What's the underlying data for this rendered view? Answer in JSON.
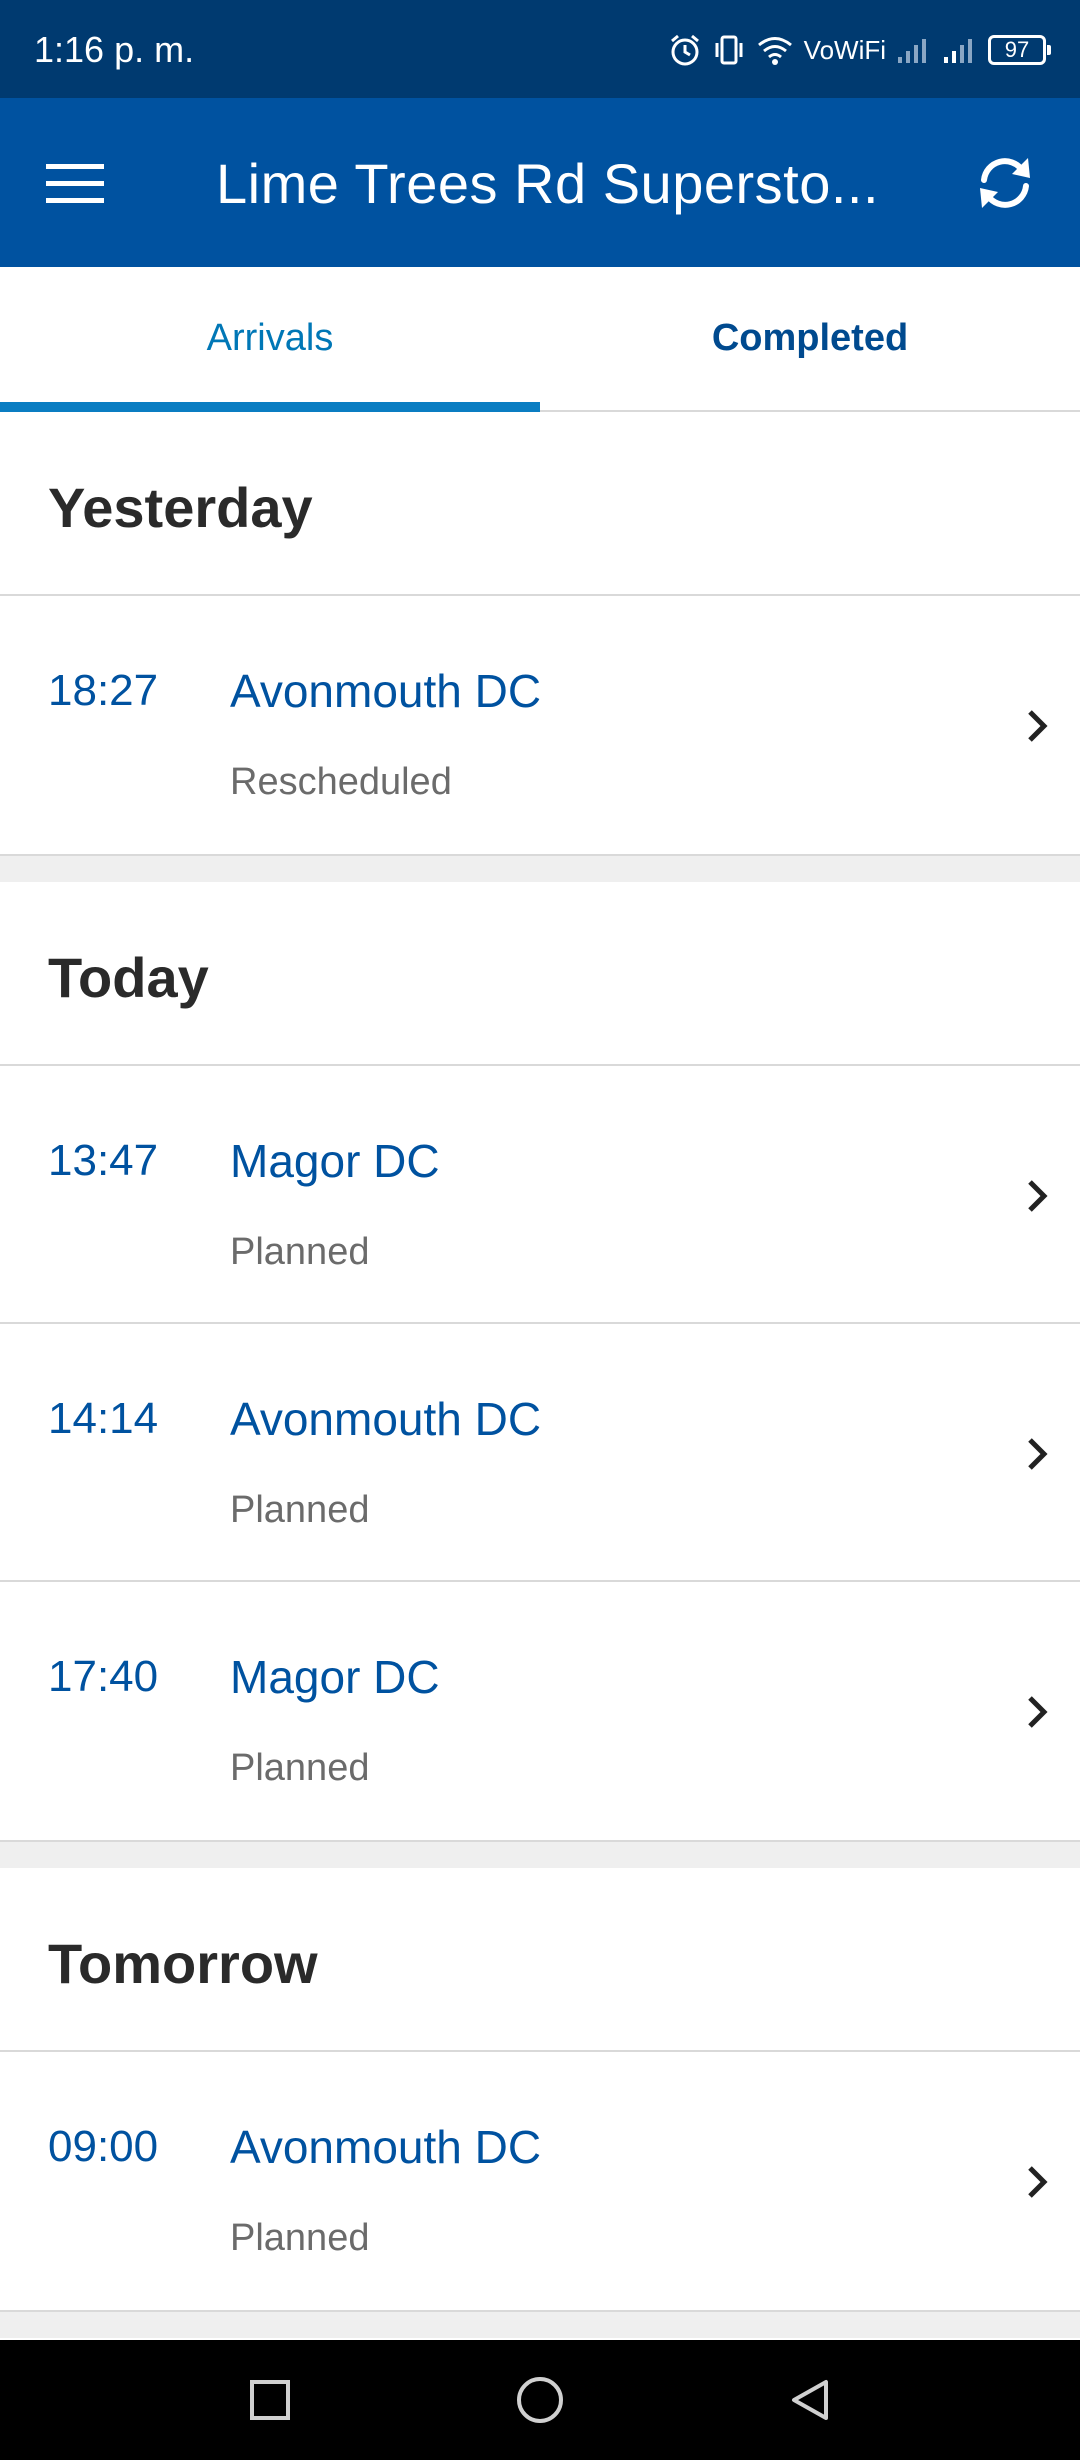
{
  "status_bar": {
    "time": "1:16 p. m.",
    "network_label": "VoWiFi",
    "battery": "97",
    "icons": [
      "alarm-icon",
      "vibrate-icon",
      "wifi-icon",
      "signal-icon",
      "signal-icon",
      "battery-icon"
    ]
  },
  "app_bar": {
    "title": "Lime Trees Rd Supersto...",
    "menu_icon": "menu-icon",
    "refresh_icon": "refresh-icon",
    "color": "#0052a0"
  },
  "tabs": [
    {
      "label": "Arrivals",
      "active": true
    },
    {
      "label": "Completed",
      "active": false
    }
  ],
  "sections": [
    {
      "title": "Yesterday",
      "items": [
        {
          "time": "18:27",
          "name": "Avonmouth DC",
          "status": "Rescheduled"
        }
      ]
    },
    {
      "title": "Today",
      "items": [
        {
          "time": "13:47",
          "name": "Magor DC",
          "status": "Planned"
        },
        {
          "time": "14:14",
          "name": "Avonmouth DC",
          "status": "Planned"
        },
        {
          "time": "17:40",
          "name": "Magor DC",
          "status": "Planned"
        }
      ]
    },
    {
      "title": "Tomorrow",
      "items": [
        {
          "time": "09:00",
          "name": "Avonmouth DC",
          "status": "Planned"
        }
      ]
    }
  ],
  "nav_bar": {
    "icons": [
      "recents-square-icon",
      "home-circle-icon",
      "back-triangle-icon"
    ]
  }
}
